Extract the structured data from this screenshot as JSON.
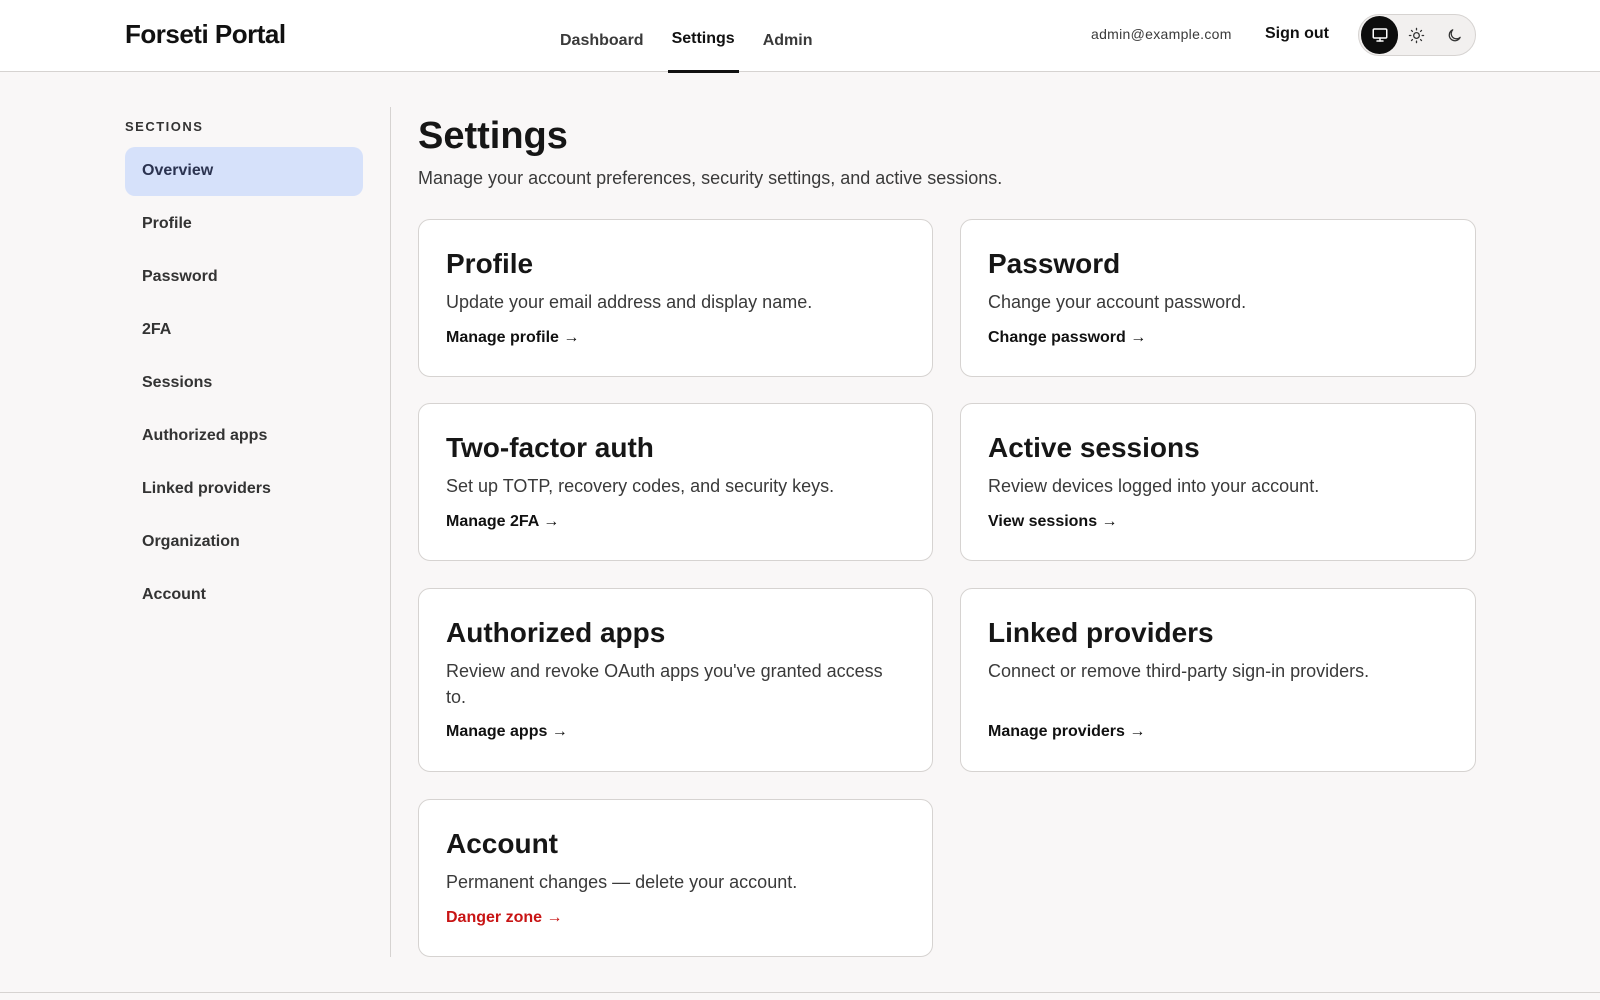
{
  "app": {
    "title": "Forseti Portal"
  },
  "nav": {
    "tabs": [
      {
        "label": "Dashboard"
      },
      {
        "label": "Settings",
        "active": true
      },
      {
        "label": "Admin"
      }
    ]
  },
  "user": {
    "email": "admin@example.com",
    "signout_label": "Sign out"
  },
  "theme": {
    "options": [
      "monitor-icon",
      "sun-icon",
      "moon-icon"
    ],
    "selected": "system"
  },
  "sidebar": {
    "heading": "SECTIONS",
    "items": [
      {
        "label": "Overview",
        "active": true
      },
      {
        "label": "Profile"
      },
      {
        "label": "Password"
      },
      {
        "label": "2FA"
      },
      {
        "label": "Sessions"
      },
      {
        "label": "Authorized apps"
      },
      {
        "label": "Linked providers"
      },
      {
        "label": "Organization"
      },
      {
        "label": "Account"
      }
    ]
  },
  "main": {
    "title": "Settings",
    "subtitle": "Manage your account preferences, security settings, and active sessions.",
    "cards": [
      {
        "title": "Profile",
        "description": "Update your email address and display name.",
        "link": "Manage profile →"
      },
      {
        "title": "Password",
        "description": "Change your account password.",
        "link": "Change password →"
      },
      {
        "title": "Two-factor auth",
        "description": "Set up TOTP, recovery codes, and security keys.",
        "link": "Manage 2FA →"
      },
      {
        "title": "Active sessions",
        "description": "Review devices logged into your account.",
        "link": "View sessions →"
      },
      {
        "title": "Authorized apps",
        "description": "Review and revoke OAuth apps you've granted access to.",
        "link": "Manage apps →"
      },
      {
        "title": "Linked providers",
        "description": "Connect or remove third-party sign-in providers.",
        "link": "Manage providers →"
      },
      {
        "title": "Account",
        "description": "Permanent changes — delete your account.",
        "link": "Danger zone →",
        "danger": true
      }
    ]
  },
  "colors": {
    "accent_active_bg": "#d6e1fa",
    "danger": "#c81414",
    "background": "#f9f7f7",
    "card_border": "#d6d3d1"
  }
}
